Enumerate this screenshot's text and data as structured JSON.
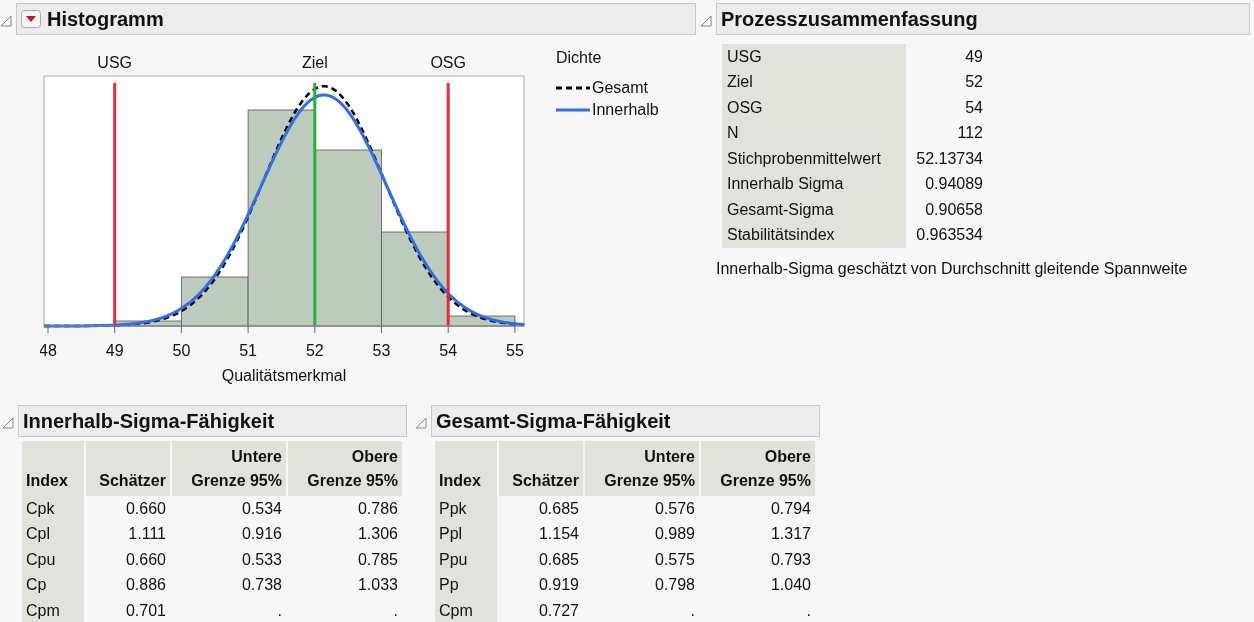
{
  "histogram": {
    "title": "Histogramm",
    "spec_limits": [
      {
        "label": "USG",
        "color": "#e8283c"
      },
      {
        "label": "Ziel",
        "color": "#22b43c"
      },
      {
        "label": "OSG",
        "color": "#e8283c"
      }
    ],
    "xticks": [
      "48",
      "49",
      "50",
      "51",
      "52",
      "53",
      "54",
      "55"
    ],
    "xlabel": "Qualitätsmerkmal",
    "legend": {
      "title": "Dichte",
      "items": [
        {
          "label": "Gesamt",
          "kind": "dashed",
          "color": "#000000"
        },
        {
          "label": "Innerhalb",
          "kind": "solid",
          "color": "#2f6fe8"
        }
      ]
    }
  },
  "process_summary": {
    "title": "Prozesszusammenfassung",
    "rows": [
      {
        "label": "USG",
        "value": "49"
      },
      {
        "label": "Ziel",
        "value": "52"
      },
      {
        "label": "OSG",
        "value": "54"
      },
      {
        "label": "N",
        "value": "112"
      },
      {
        "label": "Stichprobenmittelwert",
        "value": "52.13734"
      },
      {
        "label": "Innerhalb Sigma",
        "value": "0.94089"
      },
      {
        "label": "Gesamt-Sigma",
        "value": "0.90658"
      },
      {
        "label": "Stabilitätsindex",
        "value": "0.963534"
      }
    ],
    "note": "Innerhalb-Sigma geschätzt von Durchschnitt gleitende Spannweite"
  },
  "capability_tables": [
    {
      "title": "Innerhalb-Sigma-Fähigkeit",
      "columns": [
        "Index",
        "Schätzer",
        "Untere\nGrenze 95%",
        "Obere\nGrenze 95%"
      ],
      "rows": [
        [
          "Cpk",
          "0.660",
          "0.534",
          "0.786"
        ],
        [
          "Cpl",
          "1.111",
          "0.916",
          "1.306"
        ],
        [
          "Cpu",
          "0.660",
          "0.533",
          "0.785"
        ],
        [
          "Cp",
          "0.886",
          "0.738",
          "1.033"
        ],
        [
          "Cpm",
          "0.701",
          ".",
          "."
        ]
      ]
    },
    {
      "title": "Gesamt-Sigma-Fähigkeit",
      "columns": [
        "Index",
        "Schätzer",
        "Untere\nGrenze 95%",
        "Obere\nGrenze 95%"
      ],
      "rows": [
        [
          "Ppk",
          "0.685",
          "0.576",
          "0.794"
        ],
        [
          "Ppl",
          "1.154",
          "0.989",
          "1.317"
        ],
        [
          "Ppu",
          "0.685",
          "0.575",
          "0.793"
        ],
        [
          "Pp",
          "0.919",
          "0.798",
          "1.040"
        ],
        [
          "Cpm",
          "0.727",
          ".",
          "."
        ]
      ]
    }
  ]
}
